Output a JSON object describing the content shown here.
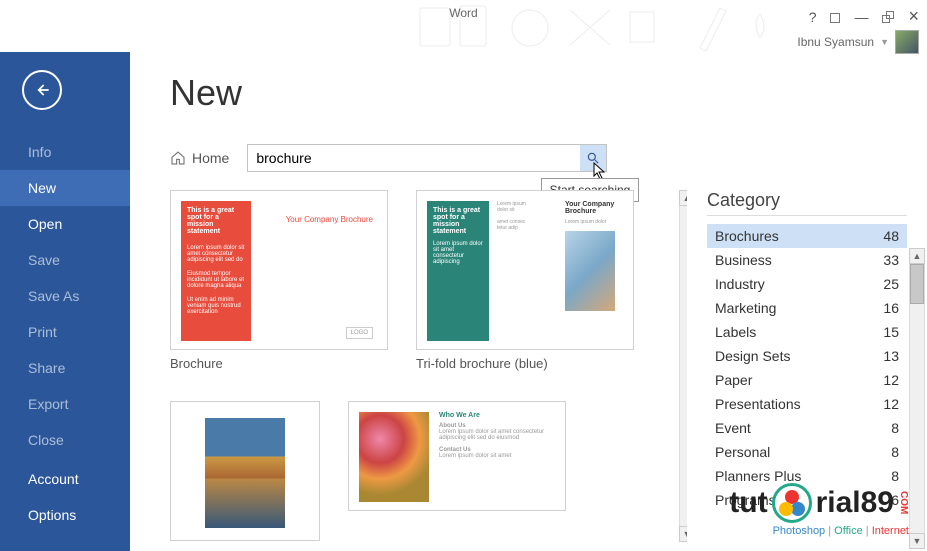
{
  "app_title": "Word",
  "user": {
    "name": "Ibnu Syamsun"
  },
  "sidebar": {
    "items": [
      {
        "label": "Info",
        "selected": false,
        "bright": false
      },
      {
        "label": "New",
        "selected": true,
        "bright": true
      },
      {
        "label": "Open",
        "selected": false,
        "bright": true
      },
      {
        "label": "Save",
        "selected": false,
        "bright": false
      },
      {
        "label": "Save As",
        "selected": false,
        "bright": false
      },
      {
        "label": "Print",
        "selected": false,
        "bright": false
      },
      {
        "label": "Share",
        "selected": false,
        "bright": false
      },
      {
        "label": "Export",
        "selected": false,
        "bright": false
      },
      {
        "label": "Close",
        "selected": false,
        "bright": false
      }
    ],
    "bottom": [
      {
        "label": "Account"
      },
      {
        "label": "Options"
      }
    ]
  },
  "page": {
    "title": "New",
    "breadcrumb": "Home"
  },
  "search": {
    "value": "brochure",
    "tooltip": "Start searching"
  },
  "templates": [
    {
      "name": "Brochure",
      "headline": "This is a great spot for a mission statement",
      "company": "Your Company Brochure",
      "logo": "LOGO"
    },
    {
      "name": "Tri-fold brochure (blue)",
      "headline": "This is a great spot for a mission statement",
      "company": "Your Company Brochure"
    },
    {
      "name": "",
      "who": "Who We Are",
      "about": "About Us",
      "contact": "Contact Us"
    },
    {
      "name": ""
    }
  ],
  "category": {
    "header": "Category",
    "items": [
      {
        "label": "Brochures",
        "count": 48,
        "selected": true
      },
      {
        "label": "Business",
        "count": 33
      },
      {
        "label": "Industry",
        "count": 25
      },
      {
        "label": "Marketing",
        "count": 16
      },
      {
        "label": "Labels",
        "count": 15
      },
      {
        "label": "Design Sets",
        "count": 13
      },
      {
        "label": "Paper",
        "count": 12
      },
      {
        "label": "Presentations",
        "count": 12
      },
      {
        "label": "Event",
        "count": 8
      },
      {
        "label": "Personal",
        "count": 8
      },
      {
        "label": "Planners Plus",
        "count": 8
      },
      {
        "label": "Programs",
        "count": 6
      }
    ]
  },
  "watermark": {
    "brand_pre": "tut",
    "brand_post": "rial89",
    "com": "COM",
    "tag_photoshop": "Photoshop",
    "tag_office": "Office",
    "tag_internet": "Internet",
    "sep": " | "
  }
}
